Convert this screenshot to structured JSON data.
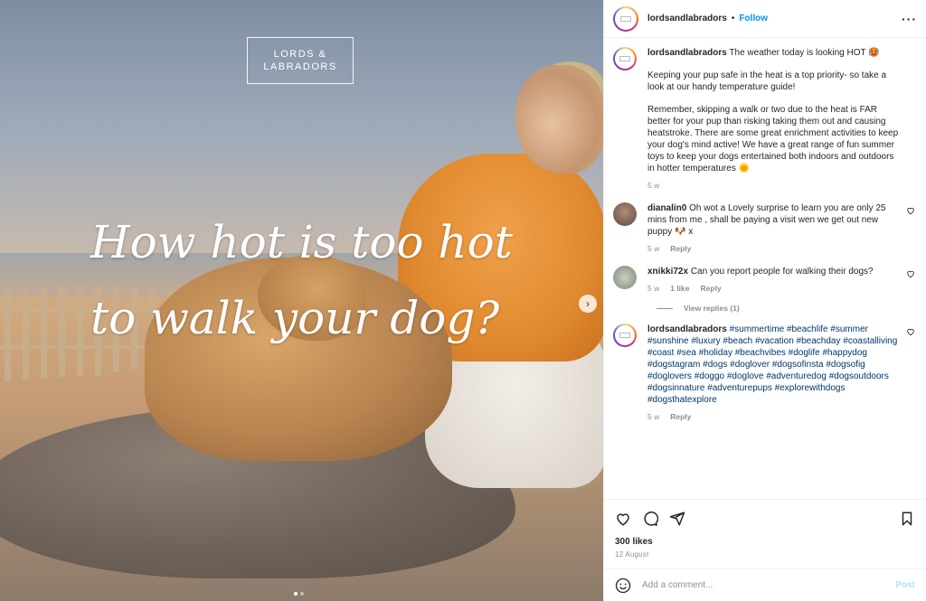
{
  "media": {
    "logo_line1": "LORDS &",
    "logo_line2": "LABRADORS",
    "headline_line1": "How hot is too hot",
    "headline_line2": "to walk your dog?",
    "next_icon": "›",
    "slide_count": 2,
    "active_slide": 1
  },
  "header": {
    "username": "lordsandlabradors",
    "separator": "•",
    "follow_label": "Follow",
    "more_icon": "···"
  },
  "caption": {
    "username": "lordsandlabradors",
    "line1": "The weather today is looking HOT 🥵",
    "para2": "Keeping your pup safe in the heat is a top priority- so take a look at our handy temperature guide!",
    "para3": "Remember, skipping a walk or two due to the heat is FAR better for your pup than risking taking them out and causing heatstroke. There are some great enrichment activities to keep your dog's mind active! We have a great range of fun summer toys to keep your dogs entertained both indoors and outdoors in hotter temperatures 🌞",
    "time": "5 w"
  },
  "comments": [
    {
      "username": "dianalin0",
      "text": "Oh wot a Lovely surprise to learn you are only 25 mins from me , shall be paying a visit wen we get out new puppy 🐶 x",
      "time": "5 w",
      "likes": "",
      "reply_label": "Reply"
    },
    {
      "username": "xnikki72x",
      "text": "Can you report people for walking their dogs?",
      "time": "5 w",
      "likes": "1 like",
      "reply_label": "Reply"
    }
  ],
  "view_replies": "View replies (1)",
  "tag_comment": {
    "username": "lordsandlabradors",
    "text": "#summertime #beachlife #summer #sunshine #luxury #beach #vacation #beachday #coastalliving #coast #sea #holiday #beachvibes #doglife #happydog #dogstagram #dogs #doglover #dogsofinsta #dogsofig #doglovers #doggo #doglove #adventuredog #dogsoutdoors #dogsinnature #adventurepups #explorewithdogs #dogsthatexplore",
    "time": "5 w",
    "reply_label": "Reply"
  },
  "footer": {
    "likes": "300 likes",
    "date": "12 August",
    "comment_placeholder": "Add a comment...",
    "post_label": "Post"
  },
  "colors": {
    "accent": "#0095f6",
    "hashtag": "#00376b",
    "muted": "#8e8e8e"
  }
}
